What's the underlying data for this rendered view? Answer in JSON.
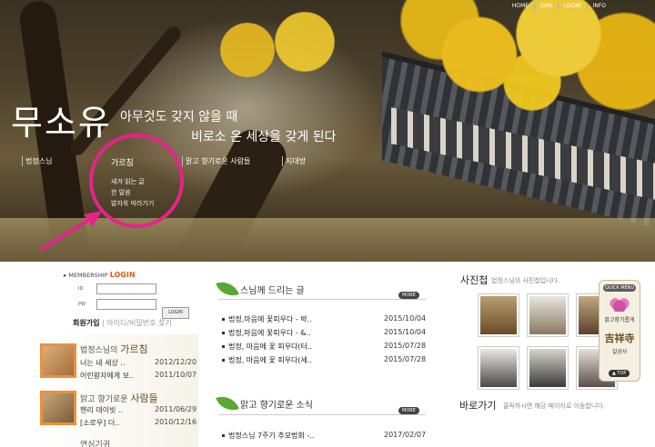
{
  "topnav": [
    "HOME",
    "JOIN",
    "LOGIN",
    "INFO"
  ],
  "logo": "무소유",
  "tagline": {
    "line1": "아무것도 갖지 않을 때",
    "line2": "비로소 온 세상을 갖게 된다"
  },
  "menu": {
    "items": [
      "법정스님",
      "가르침",
      "맑고 향기로운 사람들",
      "지대방"
    ],
    "submenu_title": "가르침",
    "submenu": [
      "새겨 읽는 글",
      "한 말씀",
      "발자욱 따라가기"
    ]
  },
  "login": {
    "title": "MEMBERSHIP",
    "title_accent": "LOGIN",
    "id_label": "ID",
    "pw_label": "PW",
    "button": "LOGIN",
    "join": "회원가입",
    "find": "아이디/비밀번호 찾기"
  },
  "teachings": {
    "heading_prefix": "법정스님의",
    "heading": "가르침",
    "items": [
      {
        "text": "너는 네 세상 ..",
        "date": "2012/12/20"
      },
      {
        "text": "어린왕자에게 보..",
        "date": "2011/10/07"
      }
    ],
    "heading2_prefix": "맑고 향기로운",
    "heading2": "사람들",
    "items2": [
      {
        "text": "헨리 데이빗 ..",
        "date": "2011/06/29"
      },
      {
        "text": "[소로우] 더..",
        "date": "2010/12/16"
      }
    ],
    "heading3": "연심기귀"
  },
  "monk_posts": {
    "title": "스님께 드리는 글",
    "more": "MORE",
    "items": [
      {
        "text": "법정,마음에 꽃피우다 - 박..",
        "date": "2015/10/04"
      },
      {
        "text": "법정,마음에 꽃피우다 - &..",
        "date": "2015/10/04"
      },
      {
        "text": "법정, 마음에 꽃 피우다(터..",
        "date": "2015/07/28"
      },
      {
        "text": "법정, 마음에 꽃 피우다(세..",
        "date": "2015/07/28"
      }
    ]
  },
  "news": {
    "title": "맑고 향기로운 소식",
    "more": "MORE",
    "items": [
      {
        "text": "법정스님 7주기 추모법회 -..",
        "date": "2017/02/07"
      }
    ]
  },
  "photos": {
    "title": "사진첩",
    "subtitle": "법정스님의 사진첩입니다."
  },
  "links": {
    "title": "바로가기",
    "subtitle": "클릭하시면 해당 페이지로 이동합니다."
  },
  "quick_menu": {
    "header": "QUICK MENU",
    "item1": "맑고향기롭게",
    "hanja": "吉祥寺",
    "item2": "길상사",
    "top": "▲ TOP"
  },
  "colors": {
    "accent_pink": "#e5248a",
    "login_orange": "#e85a1c",
    "leaf_green": "#5aa831"
  }
}
